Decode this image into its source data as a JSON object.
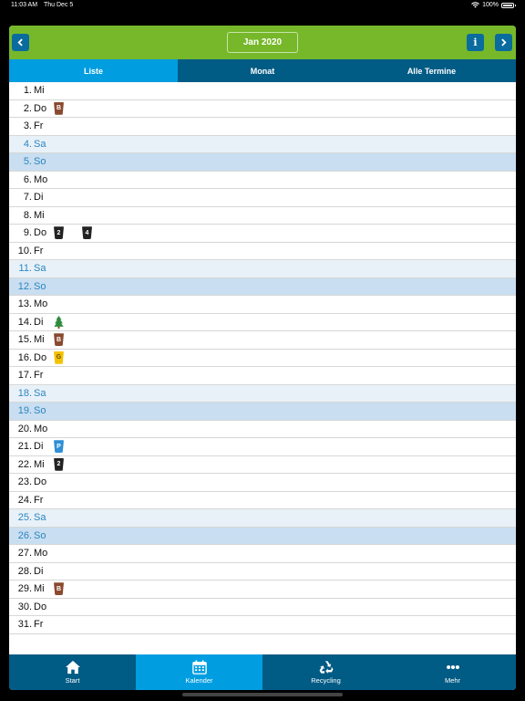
{
  "status_bar": {
    "time": "11:03 AM",
    "date": "Thu Dec 5",
    "battery": "100%"
  },
  "header": {
    "month_label": "Jan 2020",
    "info_label": "i"
  },
  "tabs": [
    {
      "label": "Liste",
      "active": true
    },
    {
      "label": "Monat",
      "active": false
    },
    {
      "label": "Alle Termine",
      "active": false
    }
  ],
  "days": [
    {
      "day": "1.",
      "weekday": "Mi",
      "type": "weekday",
      "icons": []
    },
    {
      "day": "2.",
      "weekday": "Do",
      "type": "weekday",
      "icons": [
        {
          "kind": "bin",
          "color": "brown",
          "letter": "B"
        }
      ]
    },
    {
      "day": "3.",
      "weekday": "Fr",
      "type": "weekday",
      "icons": []
    },
    {
      "day": "4.",
      "weekday": "Sa",
      "type": "sat",
      "icons": []
    },
    {
      "day": "5.",
      "weekday": "So",
      "type": "sun",
      "icons": []
    },
    {
      "day": "6.",
      "weekday": "Mo",
      "type": "weekday",
      "icons": []
    },
    {
      "day": "7.",
      "weekday": "Di",
      "type": "weekday",
      "icons": []
    },
    {
      "day": "8.",
      "weekday": "Mi",
      "type": "weekday",
      "icons": []
    },
    {
      "day": "9.",
      "weekday": "Do",
      "type": "weekday",
      "icons": [
        {
          "kind": "bin",
          "color": "black",
          "letter": "2"
        },
        {
          "kind": "bin",
          "color": "black",
          "letter": "4"
        }
      ]
    },
    {
      "day": "10.",
      "weekday": "Fr",
      "type": "weekday",
      "icons": []
    },
    {
      "day": "11.",
      "weekday": "Sa",
      "type": "sat",
      "icons": []
    },
    {
      "day": "12.",
      "weekday": "So",
      "type": "sun",
      "icons": []
    },
    {
      "day": "13.",
      "weekday": "Mo",
      "type": "weekday",
      "icons": []
    },
    {
      "day": "14.",
      "weekday": "Di",
      "type": "weekday",
      "icons": [
        {
          "kind": "tree"
        }
      ]
    },
    {
      "day": "15.",
      "weekday": "Mi",
      "type": "weekday",
      "icons": [
        {
          "kind": "bin",
          "color": "brown",
          "letter": "B"
        }
      ]
    },
    {
      "day": "16.",
      "weekday": "Do",
      "type": "weekday",
      "icons": [
        {
          "kind": "bin",
          "color": "yellow",
          "letter": "G"
        }
      ]
    },
    {
      "day": "17.",
      "weekday": "Fr",
      "type": "weekday",
      "icons": []
    },
    {
      "day": "18.",
      "weekday": "Sa",
      "type": "sat",
      "icons": []
    },
    {
      "day": "19.",
      "weekday": "So",
      "type": "sun",
      "icons": []
    },
    {
      "day": "20.",
      "weekday": "Mo",
      "type": "weekday",
      "icons": []
    },
    {
      "day": "21.",
      "weekday": "Di",
      "type": "weekday",
      "icons": [
        {
          "kind": "bin",
          "color": "blue",
          "letter": "P"
        }
      ]
    },
    {
      "day": "22.",
      "weekday": "Mi",
      "type": "weekday",
      "icons": [
        {
          "kind": "bin",
          "color": "black",
          "letter": "2"
        }
      ]
    },
    {
      "day": "23.",
      "weekday": "Do",
      "type": "weekday",
      "icons": []
    },
    {
      "day": "24.",
      "weekday": "Fr",
      "type": "weekday",
      "icons": []
    },
    {
      "day": "25.",
      "weekday": "Sa",
      "type": "sat",
      "icons": []
    },
    {
      "day": "26.",
      "weekday": "So",
      "type": "sun",
      "icons": []
    },
    {
      "day": "27.",
      "weekday": "Mo",
      "type": "weekday",
      "icons": []
    },
    {
      "day": "28.",
      "weekday": "Di",
      "type": "weekday",
      "icons": []
    },
    {
      "day": "29.",
      "weekday": "Mi",
      "type": "weekday",
      "icons": [
        {
          "kind": "bin",
          "color": "brown",
          "letter": "B"
        }
      ]
    },
    {
      "day": "30.",
      "weekday": "Do",
      "type": "weekday",
      "icons": []
    },
    {
      "day": "31.",
      "weekday": "Fr",
      "type": "weekday",
      "icons": []
    }
  ],
  "bottom_nav": [
    {
      "label": "Start",
      "icon": "home-icon",
      "active": false
    },
    {
      "label": "Kalender",
      "icon": "calendar-icon",
      "active": true
    },
    {
      "label": "Recycling",
      "icon": "recycling-icon",
      "active": false
    },
    {
      "label": "Mehr",
      "icon": "more-icon",
      "active": false
    }
  ],
  "colors": {
    "header_green": "#76b82a",
    "nav_dark_blue": "#005b85",
    "nav_active_blue": "#009de0",
    "weekend_text": "#2a86c2"
  }
}
